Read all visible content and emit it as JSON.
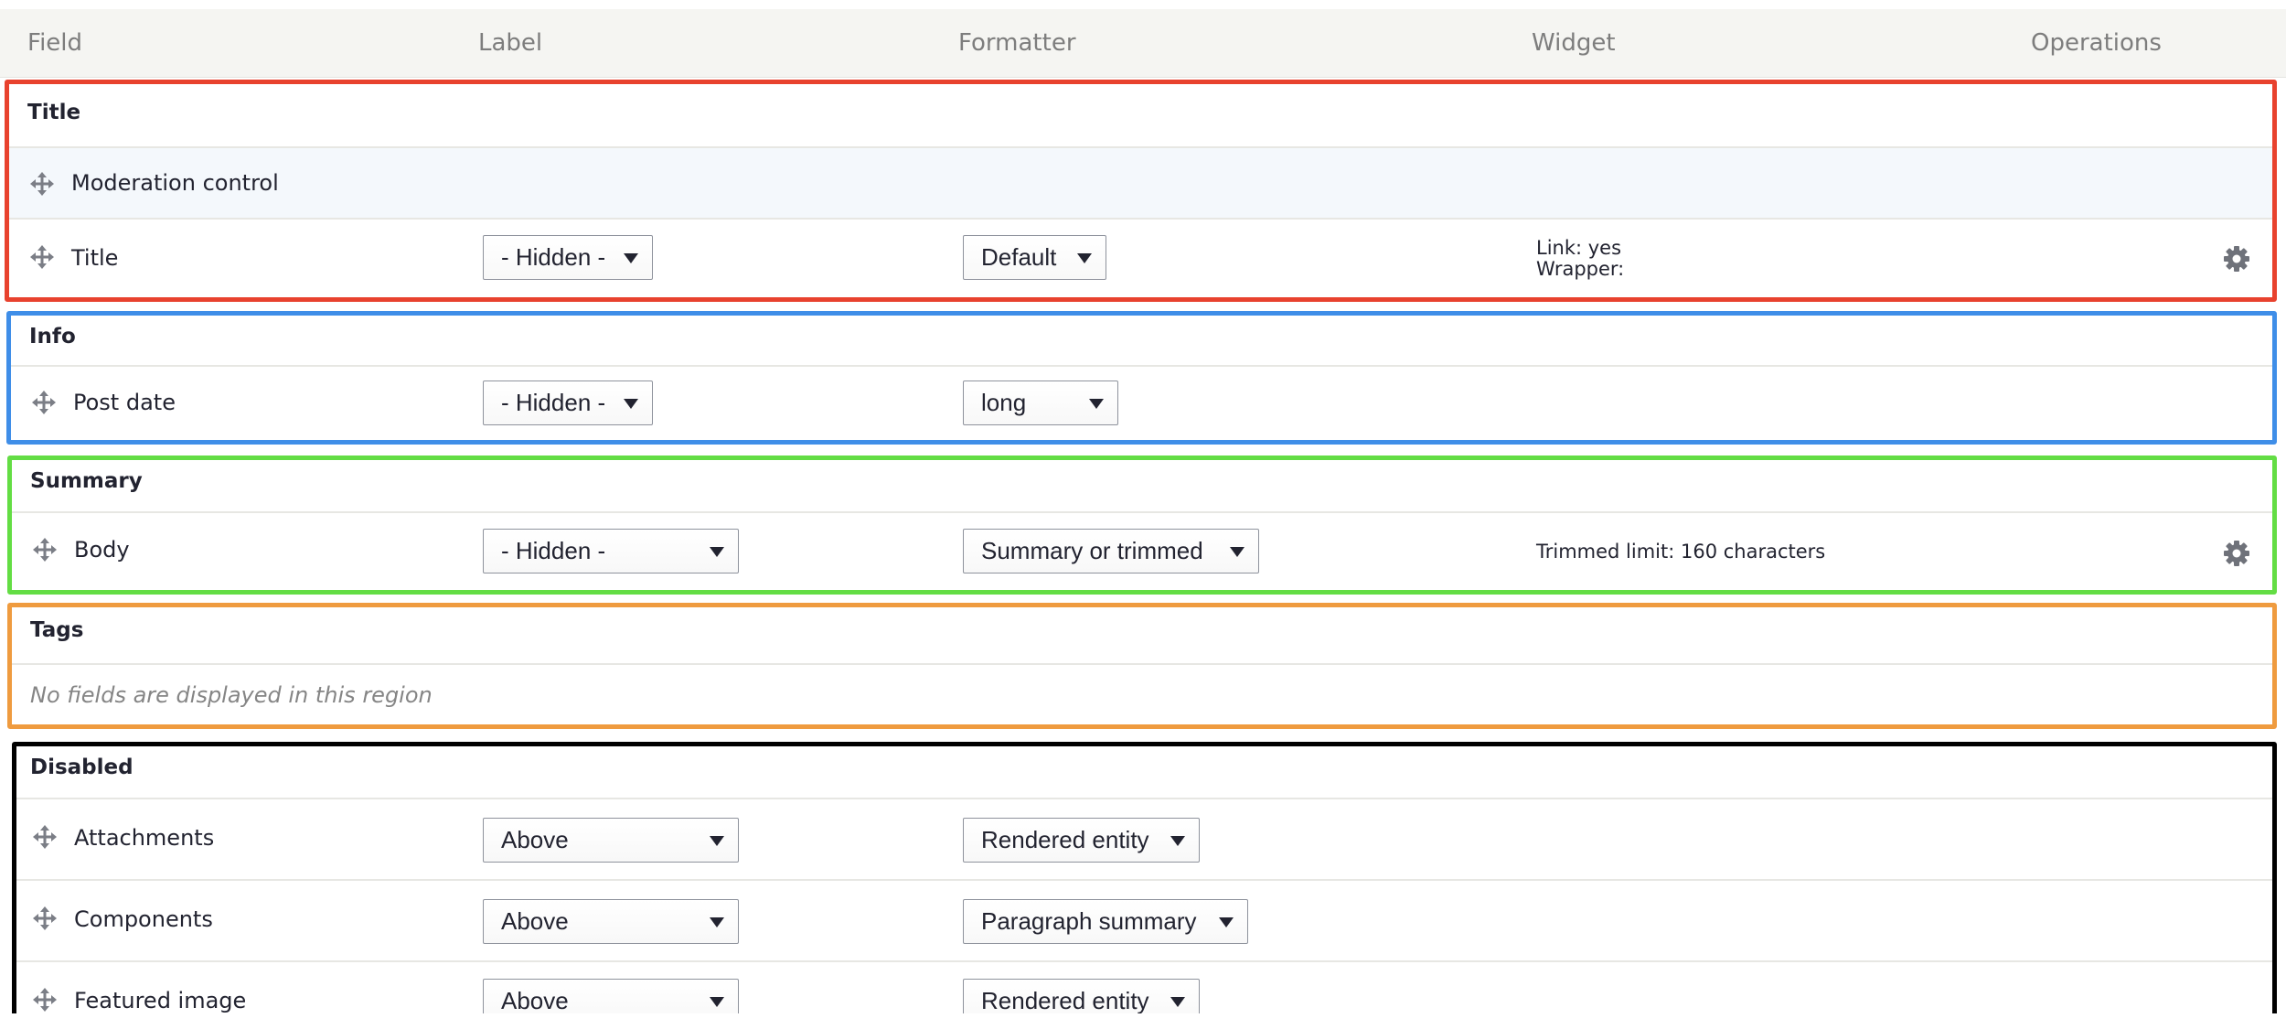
{
  "columns": {
    "field": "Field",
    "label": "Label",
    "formatter": "Formatter",
    "widget": "Widget",
    "operations": "Operations"
  },
  "colors": {
    "title_region": "#e8422e",
    "info_region": "#3f8ee8",
    "summary_region": "#63dd44",
    "tags_region": "#ef9b3f",
    "disabled_region": "#000000",
    "highlight_row": "#f4f8fc"
  },
  "regions": {
    "title": {
      "name": "Title",
      "rows": [
        {
          "field": "Moderation control"
        },
        {
          "field": "Title",
          "label": "- Hidden -",
          "formatter": "Default",
          "summary_line1": "Link: yes",
          "summary_line2": "Wrapper:"
        }
      ]
    },
    "info": {
      "name": "Info",
      "rows": [
        {
          "field": "Post date",
          "label": "- Hidden -",
          "formatter": "long"
        }
      ]
    },
    "summary": {
      "name": "Summary",
      "rows": [
        {
          "field": "Body",
          "label": "- Hidden -",
          "formatter": "Summary or trimmed",
          "summary_line1": "Trimmed limit: 160 characters"
        }
      ]
    },
    "tags": {
      "name": "Tags",
      "empty_message": "No fields are displayed in this region"
    },
    "disabled": {
      "name": "Disabled",
      "rows": [
        {
          "field": "Attachments",
          "label": "Above",
          "formatter": "Rendered entity"
        },
        {
          "field": "Components",
          "label": "Above",
          "formatter": "Paragraph summary"
        },
        {
          "field": "Featured image",
          "label": "Above",
          "formatter": "Rendered entity"
        }
      ]
    }
  },
  "icons": {
    "drag": "move-arrows-icon",
    "settings": "gear-icon",
    "select": "caret-down-icon"
  }
}
